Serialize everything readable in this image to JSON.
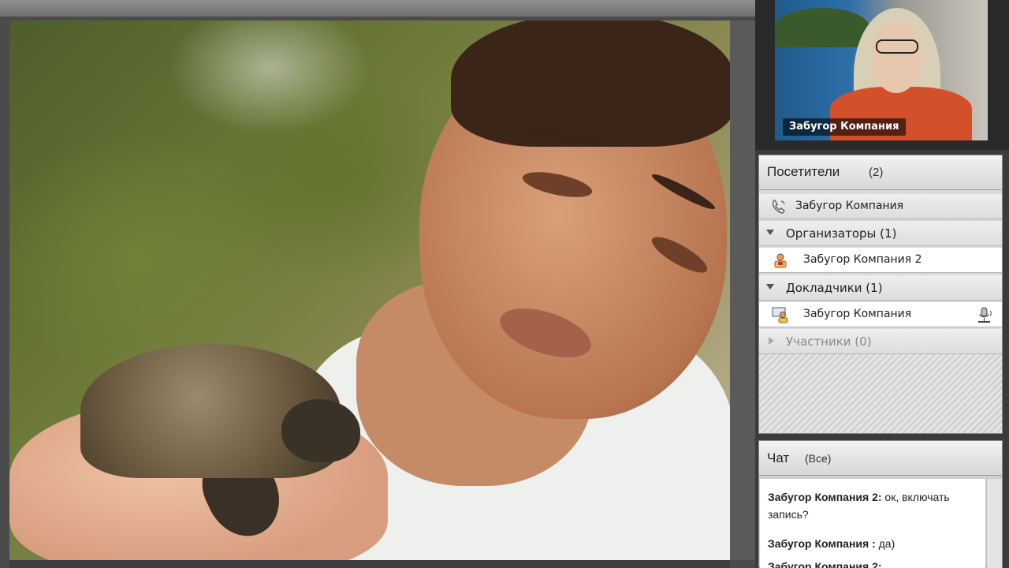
{
  "camera": {
    "name_label": "Забугор Компания"
  },
  "attendees": {
    "title": "Посетители",
    "count": "(2)",
    "phone_user": "Забугор Компания",
    "groups": [
      {
        "label": "Организаторы (1)",
        "member": "Забугор Компания  2"
      },
      {
        "label": "Докладчики (1)",
        "member": "Забугор Компания"
      },
      {
        "label": "Участники (0)"
      }
    ]
  },
  "chat": {
    "title": "Чат",
    "filter": "(Все)",
    "messages": [
      {
        "author": "Забугор Компания  2:",
        "text": " ок, включать запись?"
      },
      {
        "author": "Забугор Компания :",
        "text": " да)"
      }
    ],
    "partial_author": "Забугор Компания  2:"
  },
  "colors": {
    "pod_header_top": "#f2f2f2",
    "pod_header_bottom": "#d7d7d7",
    "camera_label_bg": "#000000",
    "background": "#3b3b3b"
  },
  "icons": [
    "phone-icon",
    "host-user-icon",
    "presenter-user-icon",
    "microphone-icon",
    "triangle-down-icon",
    "triangle-right-icon"
  ]
}
